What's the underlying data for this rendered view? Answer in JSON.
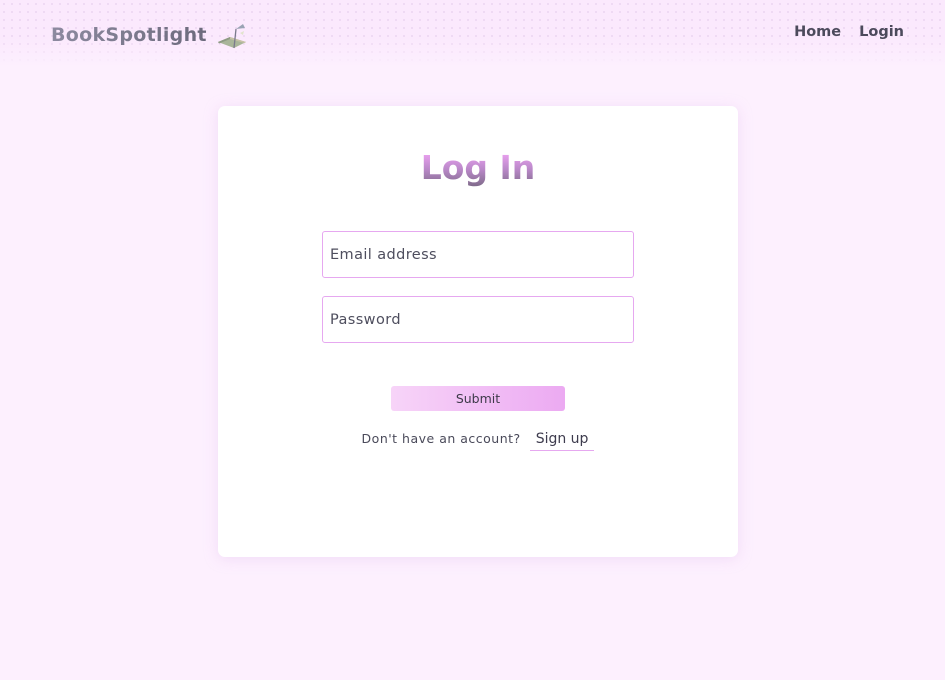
{
  "brand": {
    "name": "BookSpotlight",
    "icon": "open-book-lamp-icon"
  },
  "nav": {
    "items": [
      {
        "label": "Home"
      },
      {
        "label": "Login"
      }
    ]
  },
  "login": {
    "title": "Log In",
    "email": {
      "placeholder": "Email address",
      "value": ""
    },
    "password": {
      "placeholder": "Password",
      "value": ""
    },
    "submit_label": "Submit",
    "signup_prompt": "Don't have an account?",
    "signup_link": "Sign up"
  },
  "colors": {
    "background": "#fdf0fe",
    "accent": "#e6a8f0",
    "button_gradient_start": "#f7d4f8",
    "button_gradient_end": "#ecaaf2",
    "text": "#4a4a5a"
  }
}
